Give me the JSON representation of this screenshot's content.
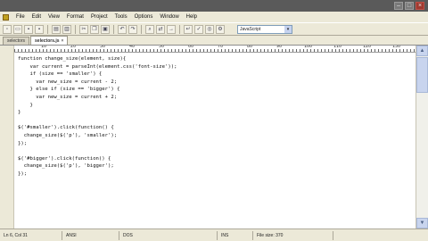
{
  "window": {
    "controls": {
      "minimize": "–",
      "maximize": "□",
      "close": "×"
    }
  },
  "menu": {
    "items": [
      "File",
      "Edit",
      "View",
      "Format",
      "Project",
      "Tools",
      "Options",
      "Window",
      "Help"
    ]
  },
  "toolbar": {
    "language": "JavaScript"
  },
  "tabs": [
    {
      "label": "selectors",
      "active": false
    },
    {
      "label": "selectors.js",
      "active": true
    }
  ],
  "ruler": {
    "labels": [
      "10",
      "20",
      "30",
      "40",
      "50",
      "60",
      "70",
      "80",
      "90",
      "100",
      "110",
      "120",
      "130"
    ]
  },
  "code": {
    "lines": [
      "function change_size(element, size){",
      "    var current = parseInt(element.css('font-size'));",
      "    if (size == 'smaller') {",
      "      var new_size = current - 2;",
      "    } else if (size == 'bigger') {",
      "      var new_size = current + 2;",
      "    }",
      "}",
      "",
      "$('#smaller').click(function() {",
      "  change_size($('p'), 'smaller');",
      "});",
      "",
      "$('#bigger').click(function() {",
      "  change_size($('p'), 'bigger');",
      "});"
    ]
  },
  "status": {
    "position": "Ln 6, Col 31",
    "encoding": "ANSI",
    "line_endings": "DOS",
    "mode": "INS",
    "file_size": "File size: 370"
  }
}
